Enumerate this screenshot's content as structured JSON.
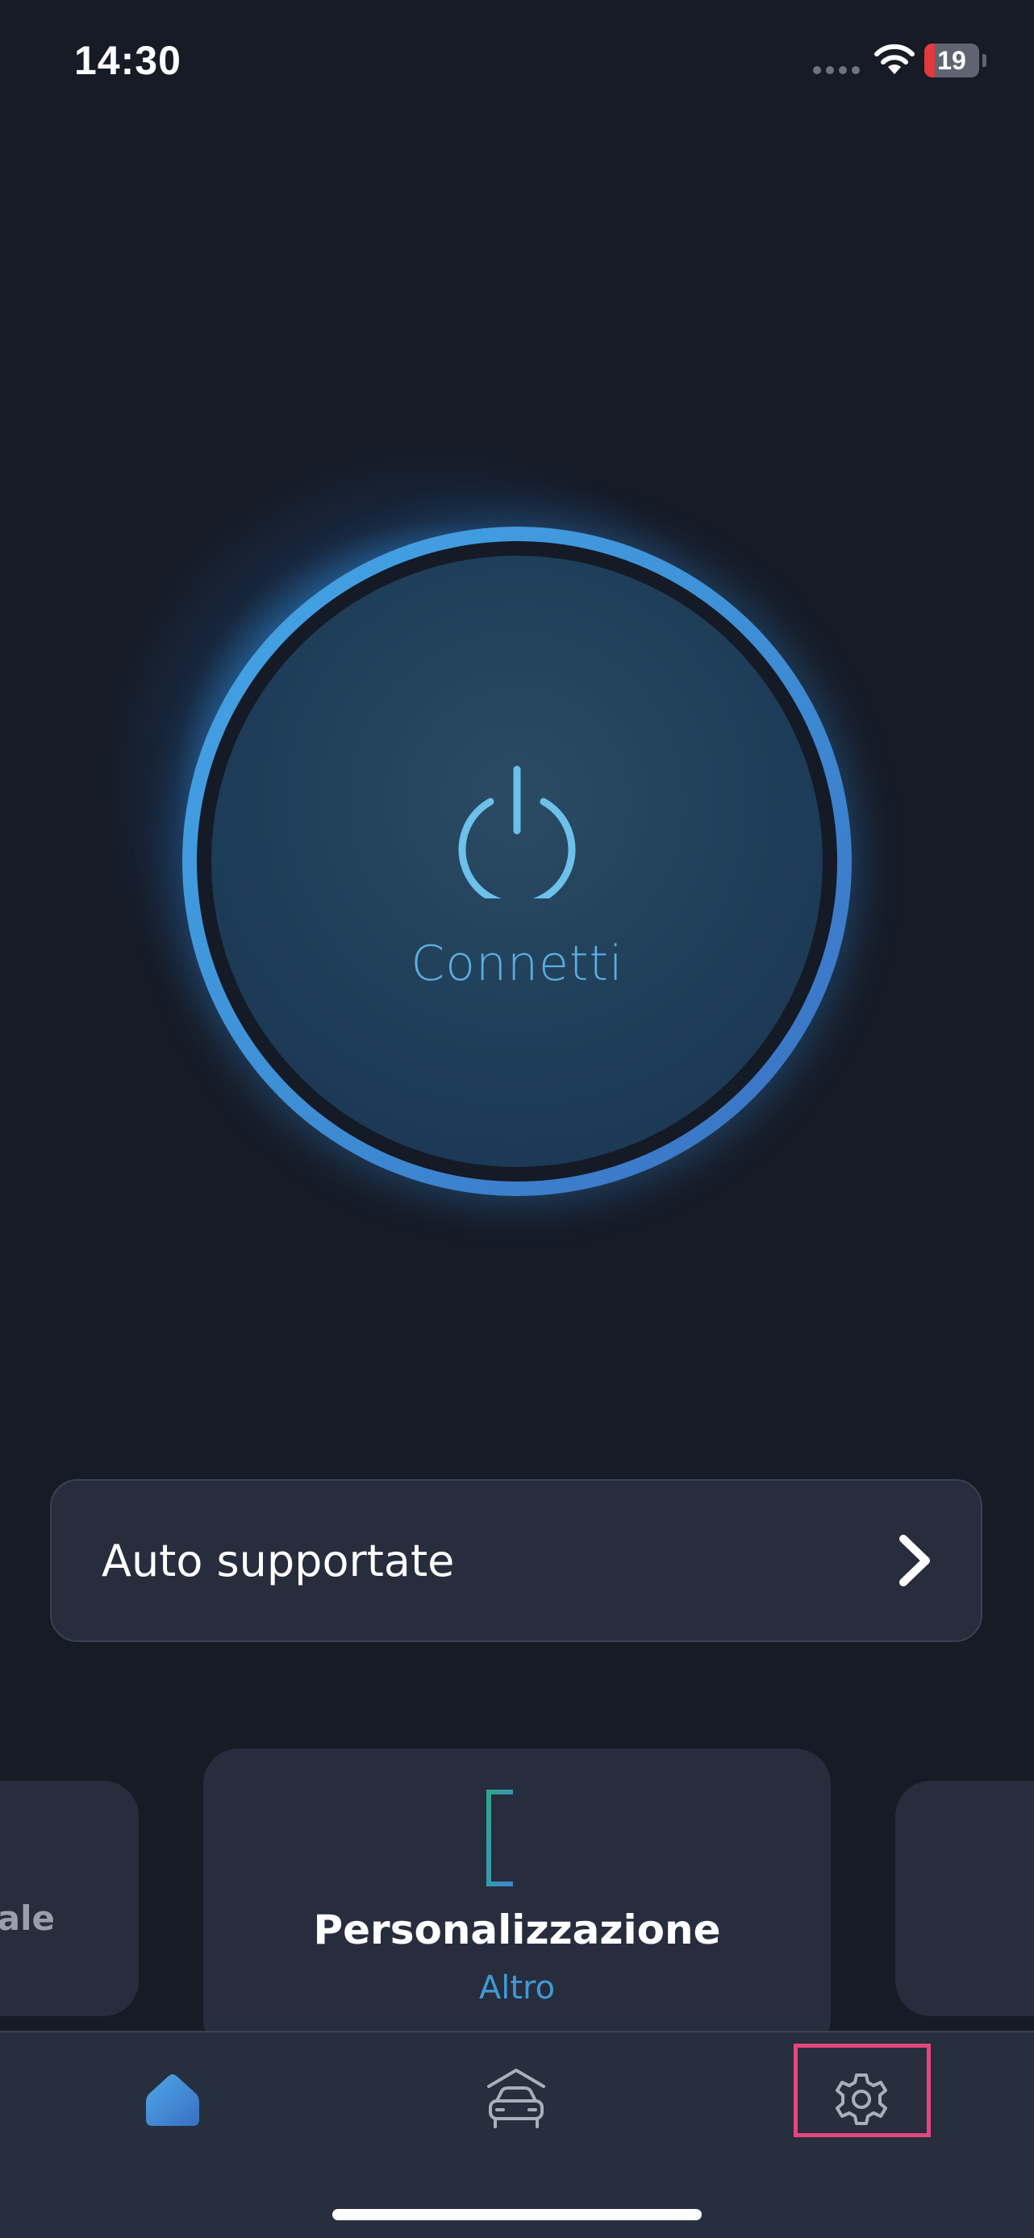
{
  "status_bar": {
    "time": "14:30",
    "battery_level": 19,
    "battery_text": "19",
    "wifi_icon": "wifi-icon",
    "signal_icon": "cellular-dots-icon"
  },
  "connect": {
    "label": "Connetti",
    "icon": "power-icon"
  },
  "supported_cars": {
    "label": "Auto supportate",
    "icon": "chevron-right-icon"
  },
  "carousel": {
    "left_card_label": "eale",
    "center_card": {
      "title": "Personalizzazione",
      "subtitle": "Altro",
      "icon": "customize-sliders-icon"
    }
  },
  "tab_bar": {
    "tabs": [
      {
        "name": "home",
        "icon": "home-icon",
        "active": true
      },
      {
        "name": "garage",
        "icon": "car-garage-icon",
        "active": false
      },
      {
        "name": "settings",
        "icon": "gear-icon",
        "active": false,
        "highlighted": true
      }
    ]
  },
  "colors": {
    "background": "#161b26",
    "accent": "#3f9ad6",
    "ring_start": "#44a6e6",
    "ring_end": "#3a6fc2",
    "card": "#272d3d",
    "highlight": "#e8457f",
    "customize_icon_start": "#2fa58c",
    "customize_icon_end": "#3a8ad6"
  }
}
